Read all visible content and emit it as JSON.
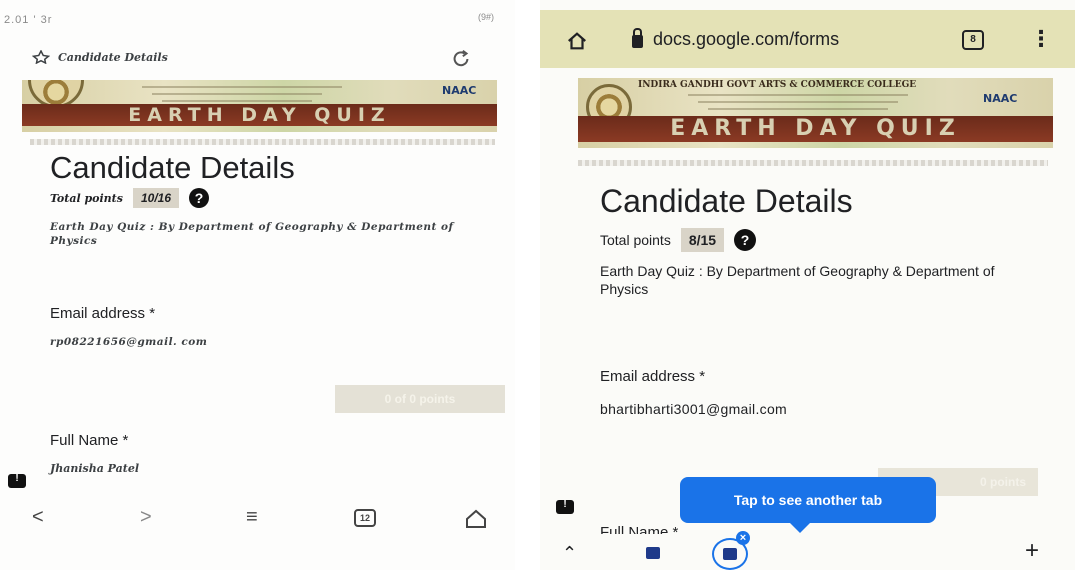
{
  "left": {
    "status": {
      "time": "2.01 ' 3r",
      "right": "(9#)"
    },
    "title": "Candidate Details",
    "banner": {
      "quiz": "EARTH DAY QUIZ",
      "naac": "NAAC"
    },
    "heading": "Candidate Details",
    "points_label": "Total points",
    "points_value": "10/16",
    "description": "Earth Day Quiz : By Department of Geography & Department of Physics",
    "email_label": "Email address *",
    "email_value": "rp08221656@gmail. com",
    "score_badge": "0 of 0 points",
    "name_label": "Full Name *",
    "name_value": "Jhanisha Patel",
    "nav": {
      "tab_count": "12"
    }
  },
  "right": {
    "url": "docs.google.com/forms",
    "tab_count": "8",
    "banner": {
      "college": "INDIRA GANDHI GOVT ARTS & COMMERCE COLLEGE",
      "quiz": "EARTH DAY QUIZ",
      "naac": "NAAC"
    },
    "heading": "Candidate Details",
    "points_label": "Total points",
    "points_value": "8/15",
    "description": "Earth Day Quiz : By Department of Geography & Department of Physics",
    "email_label": "Email address *",
    "email_value": "bhartibharti3001@gmail.com",
    "score_badge": "0 points",
    "tooltip": "Tap to see another tab",
    "fullname_label": "Full Name *"
  }
}
